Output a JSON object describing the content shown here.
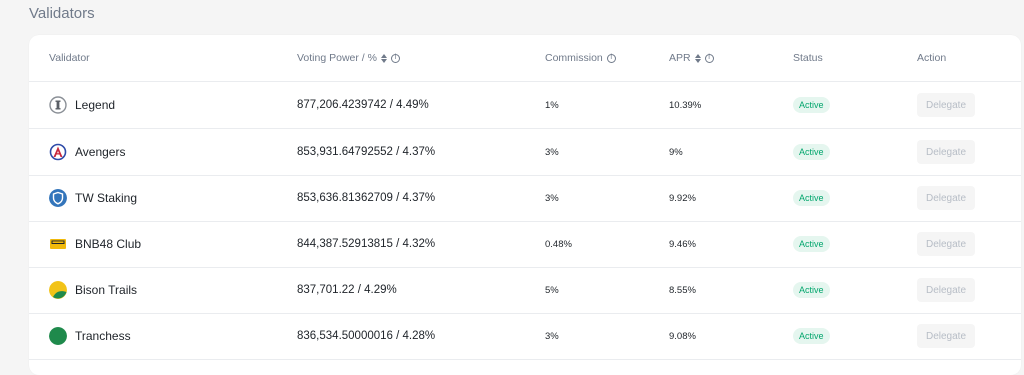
{
  "page": {
    "title": "Validators"
  },
  "table": {
    "headers": {
      "validator": "Validator",
      "voting_power": "Voting Power / %",
      "commission": "Commission",
      "apr": "APR",
      "status": "Status",
      "action": "Action"
    },
    "rows": [
      {
        "name": "Legend",
        "voting_power": "877,206.4239742 / 4.49%",
        "commission": "1%",
        "apr": "10.39%",
        "status": "Active",
        "action": "Delegate",
        "icon": "legend-logo-icon"
      },
      {
        "name": "Avengers",
        "voting_power": "853,931.64792552 / 4.37%",
        "commission": "3%",
        "apr": "9%",
        "status": "Active",
        "action": "Delegate",
        "icon": "avengers-logo-icon"
      },
      {
        "name": "TW Staking",
        "voting_power": "853,636.81362709 / 4.37%",
        "commission": "3%",
        "apr": "9.92%",
        "status": "Active",
        "action": "Delegate",
        "icon": "tw-staking-shield-icon"
      },
      {
        "name": "BNB48 Club",
        "voting_power": "844,387.52913815 / 4.32%",
        "commission": "0.48%",
        "apr": "9.46%",
        "status": "Active",
        "action": "Delegate",
        "icon": "bnb48-logo-icon"
      },
      {
        "name": "Bison Trails",
        "voting_power": "837,701.22 / 4.29%",
        "commission": "5%",
        "apr": "8.55%",
        "status": "Active",
        "action": "Delegate",
        "icon": "bison-trails-logo-icon"
      },
      {
        "name": "Tranchess",
        "voting_power": "836,534.50000016 / 4.28%",
        "commission": "3%",
        "apr": "9.08%",
        "status": "Active",
        "action": "Delegate",
        "icon": "tranchess-logo-icon"
      }
    ]
  },
  "colors": {
    "active_text": "#03a66d",
    "active_bg": "#e5f6ef",
    "muted": "#707a8a"
  }
}
